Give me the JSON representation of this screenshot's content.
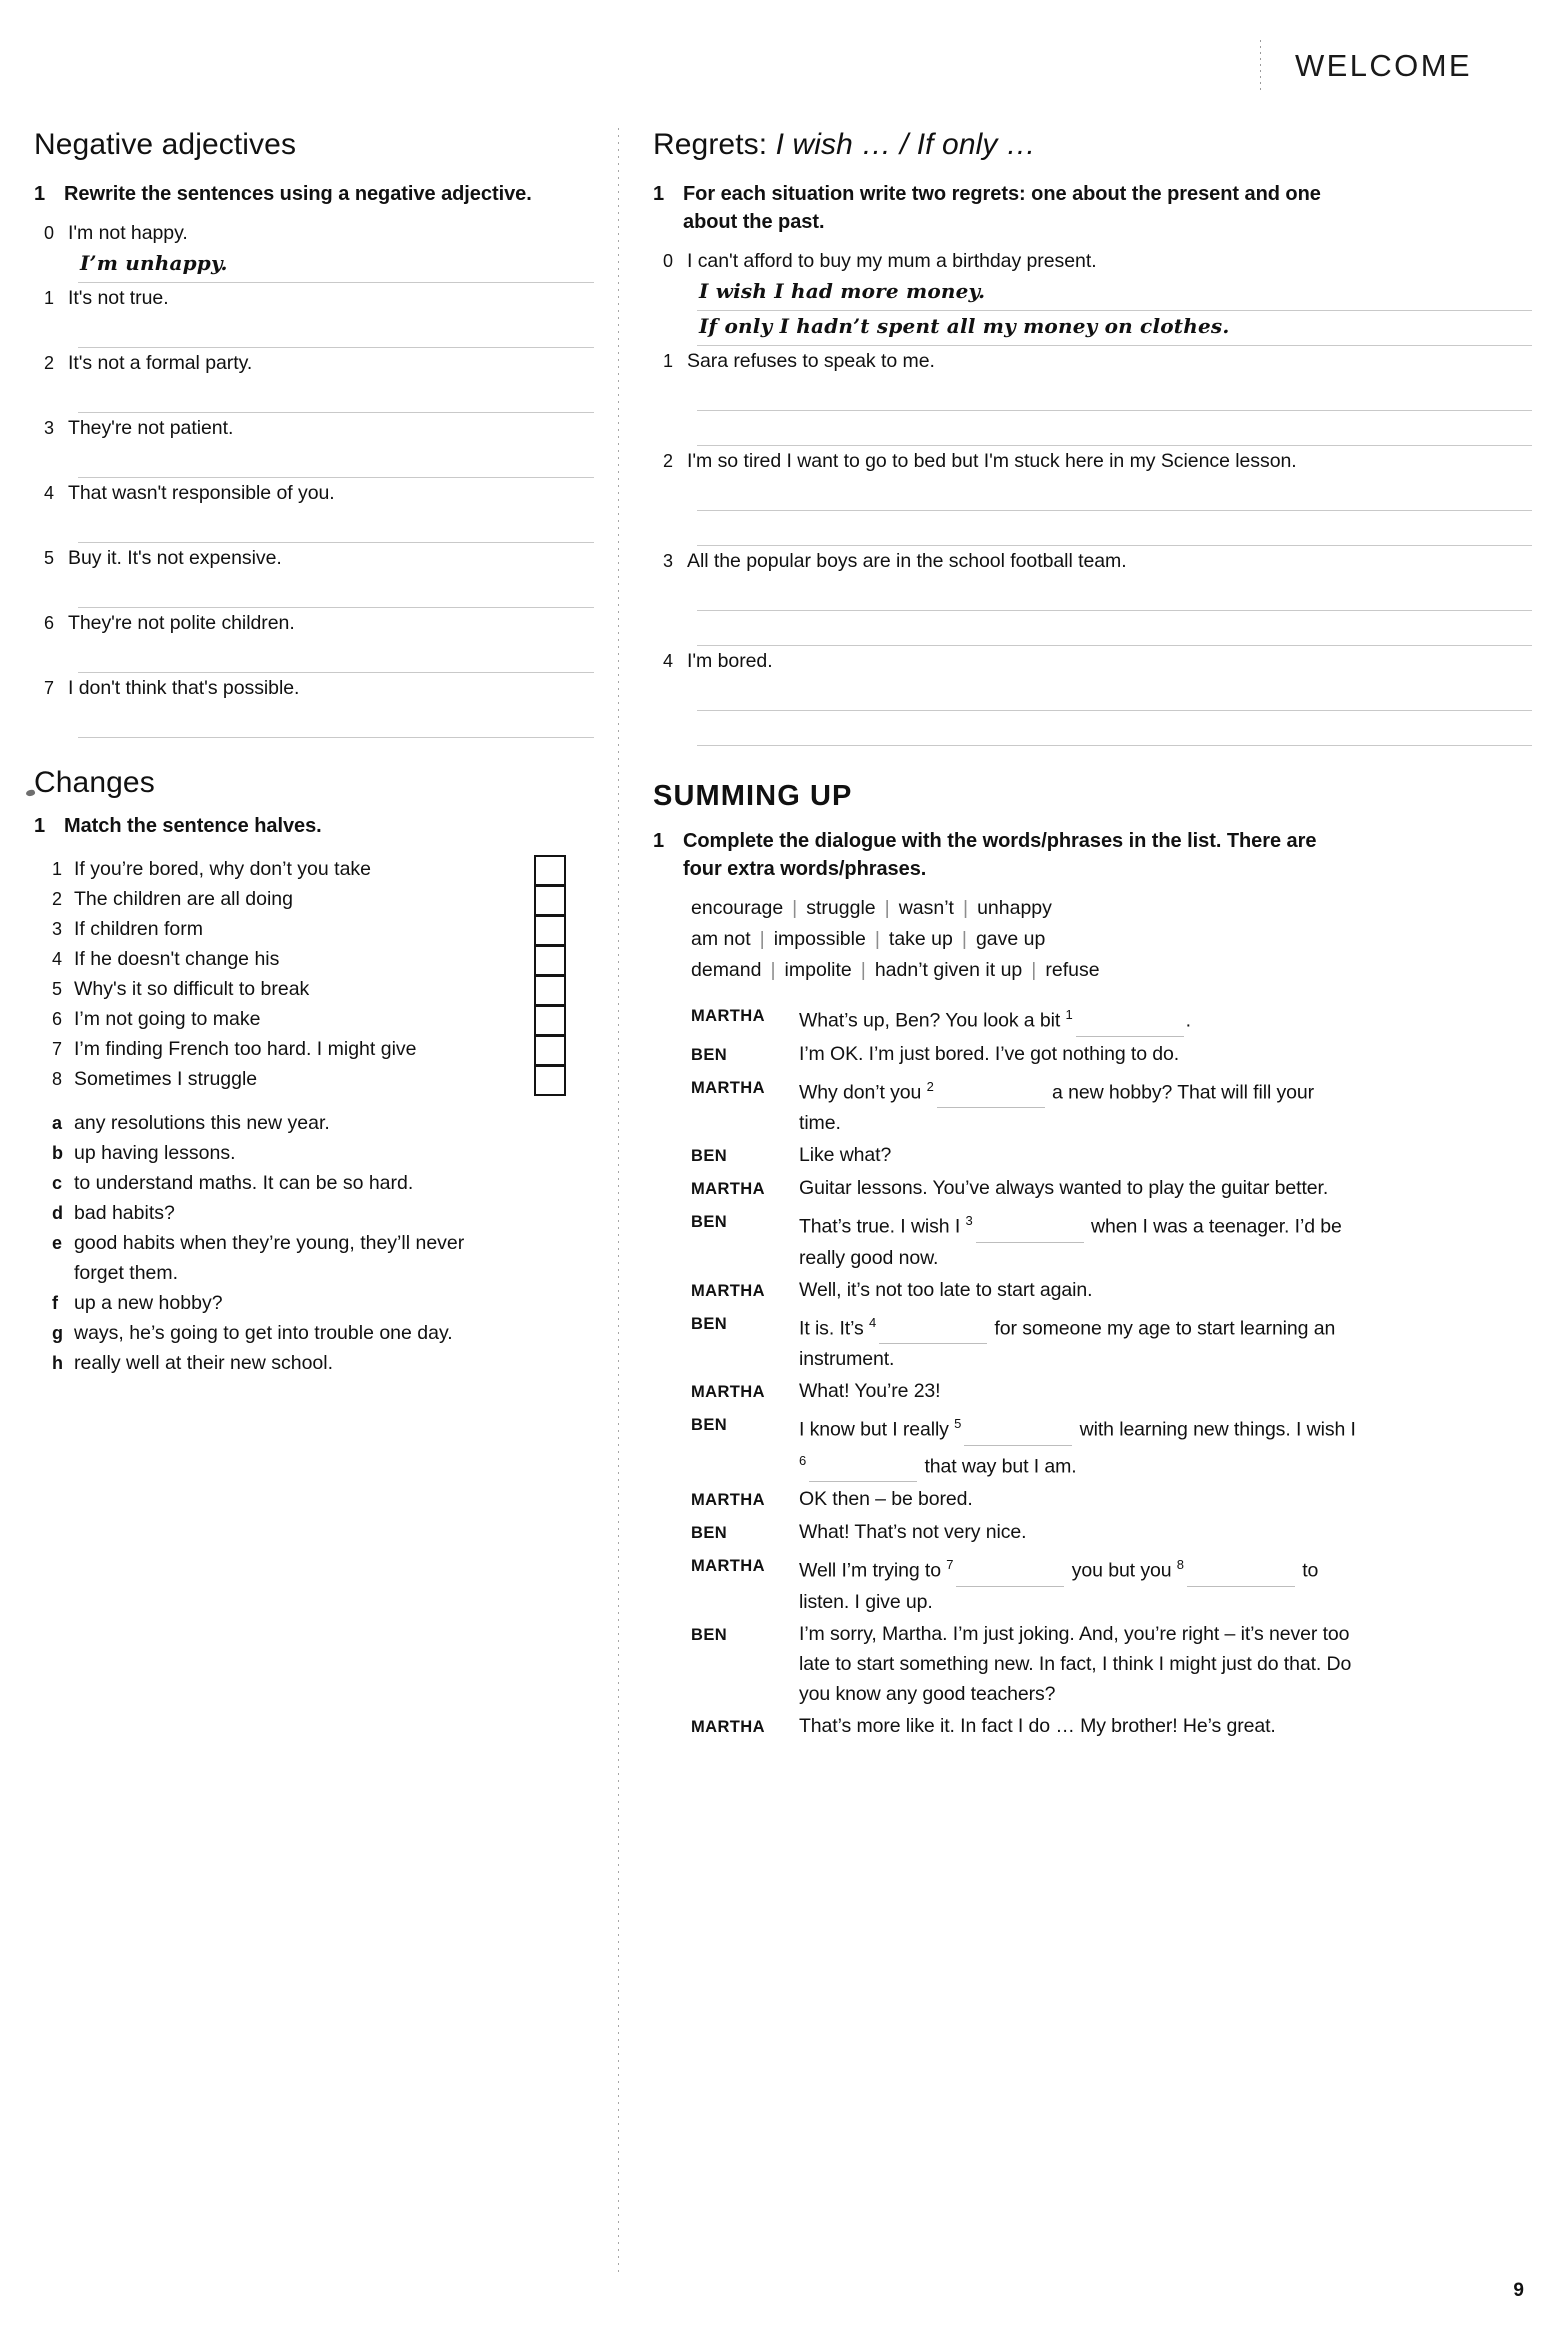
{
  "running_head": {
    "title": "WELCOME"
  },
  "folio": {
    "page_number": "9"
  },
  "left_column": {
    "section_negative_adjectives": {
      "heading": "Negative adjectives",
      "task_number": "1",
      "instruction": "Rewrite the sentences using a negative adjective.",
      "items": [
        {
          "num": "0",
          "prompt": "I'm not happy.",
          "answer": "I’m unhappy."
        },
        {
          "num": "1",
          "prompt": "It's not true.",
          "answer": ""
        },
        {
          "num": "2",
          "prompt": "It's not a formal party.",
          "answer": ""
        },
        {
          "num": "3",
          "prompt": "They're not patient.",
          "answer": ""
        },
        {
          "num": "4",
          "prompt": "That wasn't responsible of you.",
          "answer": ""
        },
        {
          "num": "5",
          "prompt": "Buy it. It's not expensive.",
          "answer": ""
        },
        {
          "num": "6",
          "prompt": "They're not polite children.",
          "answer": ""
        },
        {
          "num": "7",
          "prompt": "I don't think that's possible.",
          "answer": ""
        }
      ]
    },
    "section_changes": {
      "heading": "Changes",
      "task_number": "1",
      "instruction": "Match the sentence halves.",
      "halves": [
        {
          "num": "1",
          "text": "If you’re bored, why don’t you take"
        },
        {
          "num": "2",
          "text": "The children are all doing"
        },
        {
          "num": "3",
          "text": "If children form"
        },
        {
          "num": "4",
          "text": "If he doesn't change his"
        },
        {
          "num": "5",
          "text": "Why's it so difficult to break"
        },
        {
          "num": "6",
          "text": "I’m not going to make"
        },
        {
          "num": "7",
          "text": "I’m finding French too hard. I might give"
        },
        {
          "num": "8",
          "text": "Sometimes I struggle"
        }
      ],
      "answer_boxes": [
        "",
        "",
        "",
        "",
        "",
        "",
        "",
        ""
      ],
      "options": [
        {
          "letter": "a",
          "text": "any resolutions this new year."
        },
        {
          "letter": "b",
          "text": "up having lessons."
        },
        {
          "letter": "c",
          "text": "to understand maths. It can be so hard."
        },
        {
          "letter": "d",
          "text": "bad habits?"
        },
        {
          "letter": "e",
          "text": "good habits when they’re young, they’ll never forget them."
        },
        {
          "letter": "f",
          "text": "up a new hobby?"
        },
        {
          "letter": "g",
          "text": "ways, he’s going to get into trouble one day."
        },
        {
          "letter": "h",
          "text": "really well at their new school."
        }
      ]
    }
  },
  "right_column": {
    "section_regrets": {
      "heading_plain": "Regrets: ",
      "heading_italic": "I wish … / If only …",
      "task_number": "1",
      "instruction": "For each situation write two regrets: one about the present and one about the past.",
      "items": [
        {
          "num": "0",
          "prompt": "I can't afford to buy my mum a birthday present.",
          "answer_present": "I wish I had more money.",
          "answer_past": "If only I hadn’t spent all my money on clothes."
        },
        {
          "num": "1",
          "prompt": "Sara refuses to speak to me.",
          "answer_present": "",
          "answer_past": ""
        },
        {
          "num": "2",
          "prompt": "I'm so tired I want to go to bed but I'm stuck here in my Science lesson.",
          "answer_present": "",
          "answer_past": ""
        },
        {
          "num": "3",
          "prompt": "All the popular boys are in the school football team.",
          "answer_present": "",
          "answer_past": ""
        },
        {
          "num": "4",
          "prompt": "I'm bored.",
          "answer_present": "",
          "answer_past": ""
        }
      ]
    },
    "section_summing_up": {
      "heading": "SUMMING UP",
      "task_number": "1",
      "instruction": "Complete the dialogue with the words/phrases in the list. There are four extra words/phrases.",
      "word_bank": [
        [
          "encourage",
          "struggle",
          "wasn’t",
          "unhappy"
        ],
        [
          "am not",
          "impossible",
          "take up",
          "gave up"
        ],
        [
          "demand",
          "impolite",
          "hadn’t given it up",
          "refuse"
        ]
      ],
      "dialogue": [
        {
          "speaker": "MARTHA",
          "parts": [
            {
              "t": "text",
              "v": "What’s up, Ben? You look a bit "
            },
            {
              "t": "gap",
              "n": "1",
              "size": "b-md"
            },
            {
              "t": "text",
              "v": "."
            }
          ]
        },
        {
          "speaker": "BEN",
          "parts": [
            {
              "t": "text",
              "v": "I’m OK. I’m just bored. I’ve got nothing to do."
            }
          ]
        },
        {
          "speaker": "MARTHA",
          "parts": [
            {
              "t": "text",
              "v": "Why don’t you "
            },
            {
              "t": "gap",
              "n": "2",
              "size": "b-md"
            },
            {
              "t": "text",
              "v": " a new hobby? That will fill your time."
            }
          ]
        },
        {
          "speaker": "BEN",
          "parts": [
            {
              "t": "text",
              "v": "Like what?"
            }
          ]
        },
        {
          "speaker": "MARTHA",
          "parts": [
            {
              "t": "text",
              "v": "Guitar lessons. You’ve always wanted to play the guitar better."
            }
          ]
        },
        {
          "speaker": "BEN",
          "parts": [
            {
              "t": "text",
              "v": "That’s true. I wish I "
            },
            {
              "t": "gap",
              "n": "3",
              "size": "b-md"
            },
            {
              "t": "text",
              "v": " when I was a teenager. I’d be really good now."
            }
          ]
        },
        {
          "speaker": "MARTHA",
          "parts": [
            {
              "t": "text",
              "v": "Well, it’s not too late to start again."
            }
          ]
        },
        {
          "speaker": "BEN",
          "parts": [
            {
              "t": "text",
              "v": "It is. It’s "
            },
            {
              "t": "gap",
              "n": "4",
              "size": "b-md"
            },
            {
              "t": "text",
              "v": " for someone my age to start learning an instrument."
            }
          ]
        },
        {
          "speaker": "MARTHA",
          "parts": [
            {
              "t": "text",
              "v": "What! You’re 23!"
            }
          ]
        },
        {
          "speaker": "BEN",
          "parts": [
            {
              "t": "text",
              "v": "I know but I really "
            },
            {
              "t": "gap",
              "n": "5",
              "size": "b-md"
            },
            {
              "t": "text",
              "v": " with learning new things. I wish I "
            },
            {
              "t": "gap",
              "n": "6",
              "size": "b-md"
            },
            {
              "t": "text",
              "v": " that way but I am."
            }
          ]
        },
        {
          "speaker": "MARTHA",
          "parts": [
            {
              "t": "text",
              "v": "OK then – be bored."
            }
          ]
        },
        {
          "speaker": "BEN",
          "parts": [
            {
              "t": "text",
              "v": "What! That’s not very nice."
            }
          ]
        },
        {
          "speaker": "MARTHA",
          "parts": [
            {
              "t": "text",
              "v": "Well I’m trying to "
            },
            {
              "t": "gap",
              "n": "7",
              "size": "b-md"
            },
            {
              "t": "text",
              "v": " you but you "
            },
            {
              "t": "gap",
              "n": "8",
              "size": "b-md"
            },
            {
              "t": "text",
              "v": " to listen. I give up."
            }
          ]
        },
        {
          "speaker": "BEN",
          "parts": [
            {
              "t": "text",
              "v": "I’m sorry, Martha. I’m just joking. And, you’re right – it’s never too late to start something new. In fact, I think I might just do that. Do you know any good teachers?"
            }
          ]
        },
        {
          "speaker": "MARTHA",
          "parts": [
            {
              "t": "text",
              "v": "That’s more like it. In fact I do … My brother! He’s great."
            }
          ]
        }
      ]
    }
  }
}
